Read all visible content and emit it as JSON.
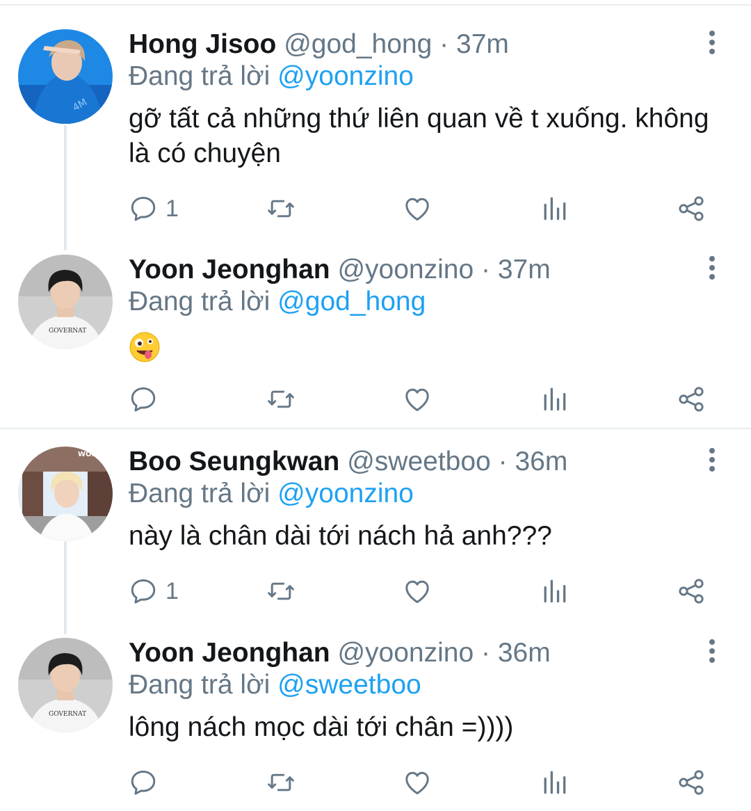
{
  "reply_prefix": "Đang trả lời",
  "colors": {
    "accent": "#1da1f2",
    "secondary": "#657786",
    "divider": "#e6ecf0"
  },
  "tweets": [
    {
      "name": "Hong Jisoo",
      "handle": "@god_hong",
      "separator": "·",
      "time": "37m",
      "reply_to": "@yoonzino",
      "text": "gỡ tất cả những thứ liên quan về t xuống. không là có chuyện",
      "reply_count": "1",
      "avatar": "avatar-blue-hoodie"
    },
    {
      "name": "Yoon Jeonghan",
      "handle": "@yoonzino",
      "separator": "·",
      "time": "37m",
      "reply_to": "@god_hong",
      "text": "",
      "emoji": "zany-face-emoji",
      "reply_count": "",
      "avatar": "avatar-white-tee"
    },
    {
      "name": "Boo Seungkwan",
      "handle": "@sweetboo",
      "separator": "·",
      "time": "36m",
      "reply_to": "@yoonzino",
      "text": "này là chân dài tới nách hả anh???",
      "reply_count": "1",
      "avatar": "avatar-blond-outdoor"
    },
    {
      "name": "Yoon Jeonghan",
      "handle": "@yoonzino",
      "separator": "·",
      "time": "36m",
      "reply_to": "@sweetboo",
      "text": "lông nách mọc dài tới chân =))))",
      "reply_count": "",
      "avatar": "avatar-white-tee"
    }
  ]
}
